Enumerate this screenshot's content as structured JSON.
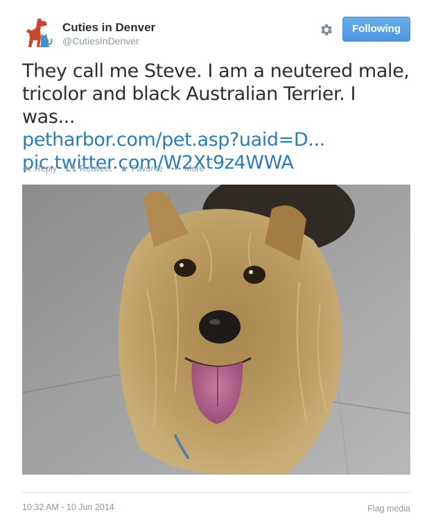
{
  "account": {
    "display_name": "Cuties in Denver",
    "handle": "@CutiesInDenver",
    "avatar_icon": "dog-cat-logo-icon"
  },
  "header": {
    "settings_icon": "gear-icon",
    "follow_label": "Following"
  },
  "tweet": {
    "text_line1": "They call me Steve. I am a neutered male,",
    "text_line2": "tricolor and black Australian Terrier. I was...",
    "link": "petharbor.com/pet.asp?uaid=D...",
    "pic_link": "pic.twitter.com/W2Xt9z4WWA"
  },
  "actions": {
    "reply": "Reply",
    "retweet": "Retweet",
    "favorite": "Favorite",
    "more": "More"
  },
  "footer": {
    "timestamp": "10:32 AM - 10 Jun 2014",
    "flag": "Flag media"
  },
  "colors": {
    "link": "#2b7bb9",
    "follow_button": "#5ea2e6",
    "muted": "#8899a6",
    "avatar_dog": "#c8452f",
    "avatar_cat": "#4a90c8"
  }
}
